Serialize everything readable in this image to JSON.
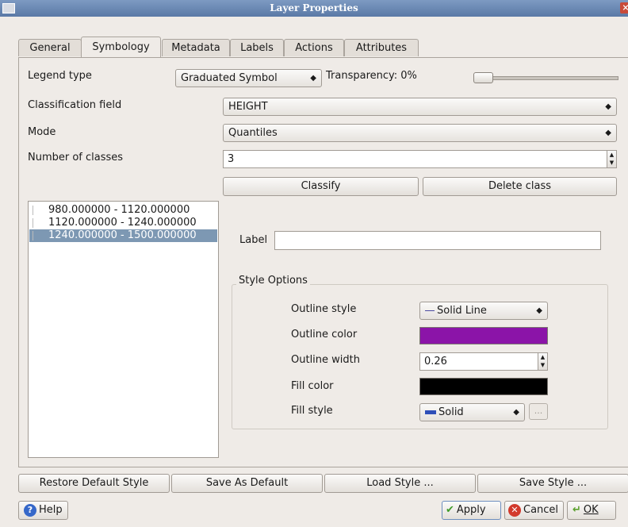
{
  "window": {
    "title": "Layer Properties",
    "close": "×"
  },
  "tabs": [
    "General",
    "Symbology",
    "Metadata",
    "Labels",
    "Actions",
    "Attributes"
  ],
  "legend": {
    "label": "Legend type",
    "value": "Graduated Symbol",
    "transparency": "Transparency: 0%"
  },
  "classification": {
    "label": "Classification field",
    "value": "HEIGHT"
  },
  "mode": {
    "label": "Mode",
    "value": "Quantiles"
  },
  "num_classes": {
    "label": "Number of classes",
    "value": "3"
  },
  "buttons": {
    "classify": "Classify",
    "delete_class": "Delete class"
  },
  "classes": [
    "980.000000 - 1120.000000",
    "1120.000000 - 1240.000000",
    "1240.000000 - 1500.000000"
  ],
  "label_field": {
    "label": "Label",
    "value": ""
  },
  "style_options": {
    "title": "Style Options",
    "outline_style_label": "Outline style",
    "outline_style_value": "Solid Line",
    "outline_color_label": "Outline color",
    "outline_color": "#8b14a8",
    "outline_width_label": "Outline width",
    "outline_width_value": "0.26",
    "fill_color_label": "Fill color",
    "fill_color": "#000000",
    "fill_style_label": "Fill style",
    "fill_style_value": "Solid",
    "more": "..."
  },
  "bottom": {
    "restore": "Restore Default Style",
    "save_default": "Save As Default",
    "load": "Load Style ...",
    "save": "Save Style ...",
    "help": "Help",
    "apply": "Apply",
    "cancel": "Cancel",
    "ok": "OK"
  },
  "icons": {
    "help": "help-icon",
    "apply": "checkmark-icon",
    "cancel": "cancel-icon",
    "ok": "ok-arrow-icon"
  }
}
